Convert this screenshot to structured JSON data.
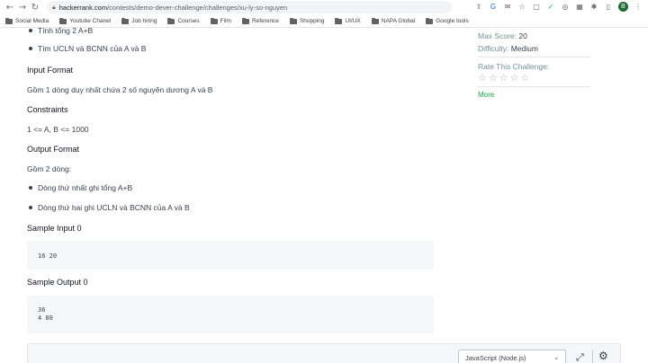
{
  "browser": {
    "url_domain": "hackerrank.com",
    "url_path": "/contests/demo-dever-challenge/challenges/xu-ly-so-nguyen",
    "profile_initial": "B",
    "bookmarks": [
      "Social Media",
      "Youtube Chanel",
      "Job hiring",
      "Courses",
      "Film",
      "Reference",
      "Shopping",
      "UI/UX",
      "NAPA Global",
      "Google tools"
    ]
  },
  "problem": {
    "bullets_top": [
      "Tính tổng 2 A+B",
      "Tìm UCLN và BCNN của A và B"
    ],
    "input_heading": "Input Format",
    "input_text": "Gồm 1 dòng duy nhất chứa 2 số nguyên dương A và B",
    "constraints_heading": "Constraints",
    "constraints_text": "1 <= A, B <= 1000",
    "output_heading": "Output Format",
    "output_intro": "Gồm 2 dòng:",
    "output_bullets": [
      "Dòng thứ nhất ghi tổng A+B",
      "Dòng thứ hai ghi UCLN và BCNN của A và B"
    ],
    "sample_input_heading": "Sample Input 0",
    "sample_input": "16 20",
    "sample_output_heading": "Sample Output 0",
    "sample_output_lines": [
      "36",
      "4 80"
    ]
  },
  "sidebar": {
    "max_score_label": "Max Score:",
    "max_score_value": "20",
    "difficulty_label": "Difficulty:",
    "difficulty_value": "Medium",
    "rate_label": "Rate This Challenge:",
    "more_label": "More"
  },
  "editor": {
    "language": "JavaScript (Node.js)"
  },
  "icons": {
    "back": "arrow-left-icon",
    "forward": "arrow-right-icon",
    "reload": "reload-icon",
    "lock": "lock-icon",
    "star": "star-outline-icon",
    "expand": "fullscreen-icon",
    "gear": "gear-icon"
  },
  "colors": {
    "accent_green": "#1ba94c",
    "sample_bg": "#f3f7f7",
    "text": "#39424e"
  }
}
